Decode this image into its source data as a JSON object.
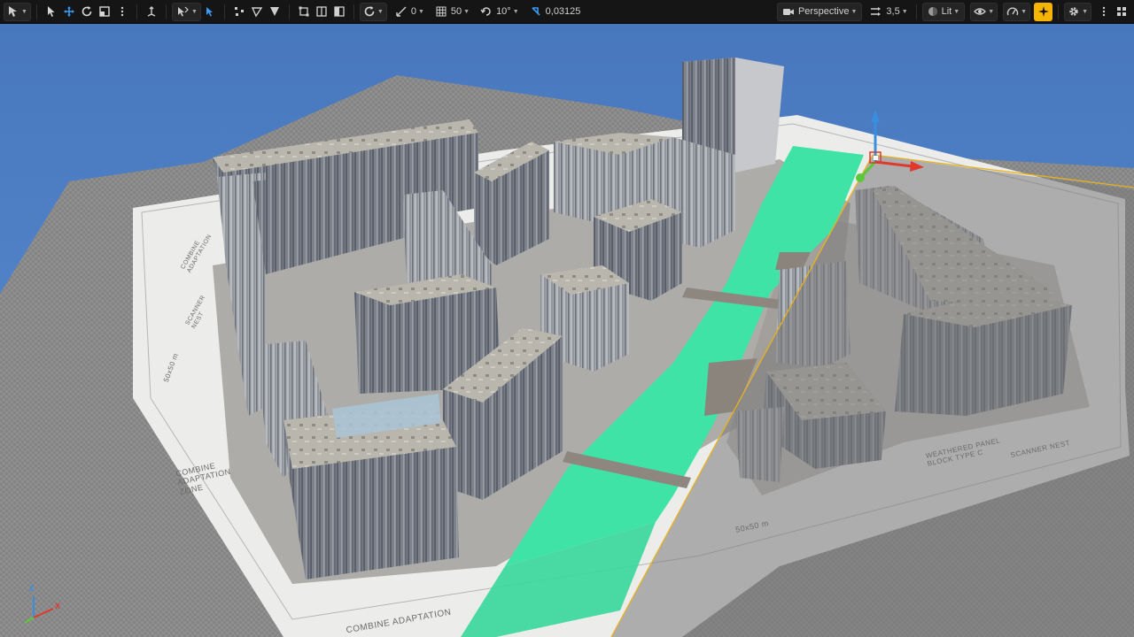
{
  "toolbar": {
    "left_icons": [
      "select-mode-icon",
      "select-arrow-icon",
      "translate-icon",
      "rotate-icon",
      "scale-icon",
      "more-options-icon"
    ],
    "camera_speed_label": "Perspective",
    "view_mode_label": "Perspective",
    "field_of_view_value": "3,5",
    "lighting_label": "Lit",
    "rotation_snap_value": "0",
    "grid_snap_value": "50",
    "angle_snap_value": "10°",
    "scale_snap_value": "0,03125"
  },
  "scene": {
    "labels": {
      "combine_zone": "COMBINE\nADAPTATION\nZONE",
      "combine_adaptation_bottom": "COMBINE ADAPTATION",
      "scale_bottom": "50x50 m",
      "scale_left": "50x50 m",
      "weathered_panel": "WEATHERED PANEL\nBLOCK TYPE C",
      "scanner_nest_right": "SCANNER NEST",
      "scanner_nest_left": "SCANNER\nNEST",
      "combine_adaptation_left": "COMBINE\nADAPTATION"
    },
    "colors": {
      "sky": "#4d7fc4",
      "ground": "#8c8c8c",
      "water": "#3ee0a0",
      "paper": "#eeeeee",
      "gizmo_x": "#e0392b",
      "gizmo_y": "#5ac83a",
      "gizmo_z": "#3a8ee0"
    }
  },
  "axis_widget": {
    "x_label": "X",
    "z_label": "Z"
  }
}
